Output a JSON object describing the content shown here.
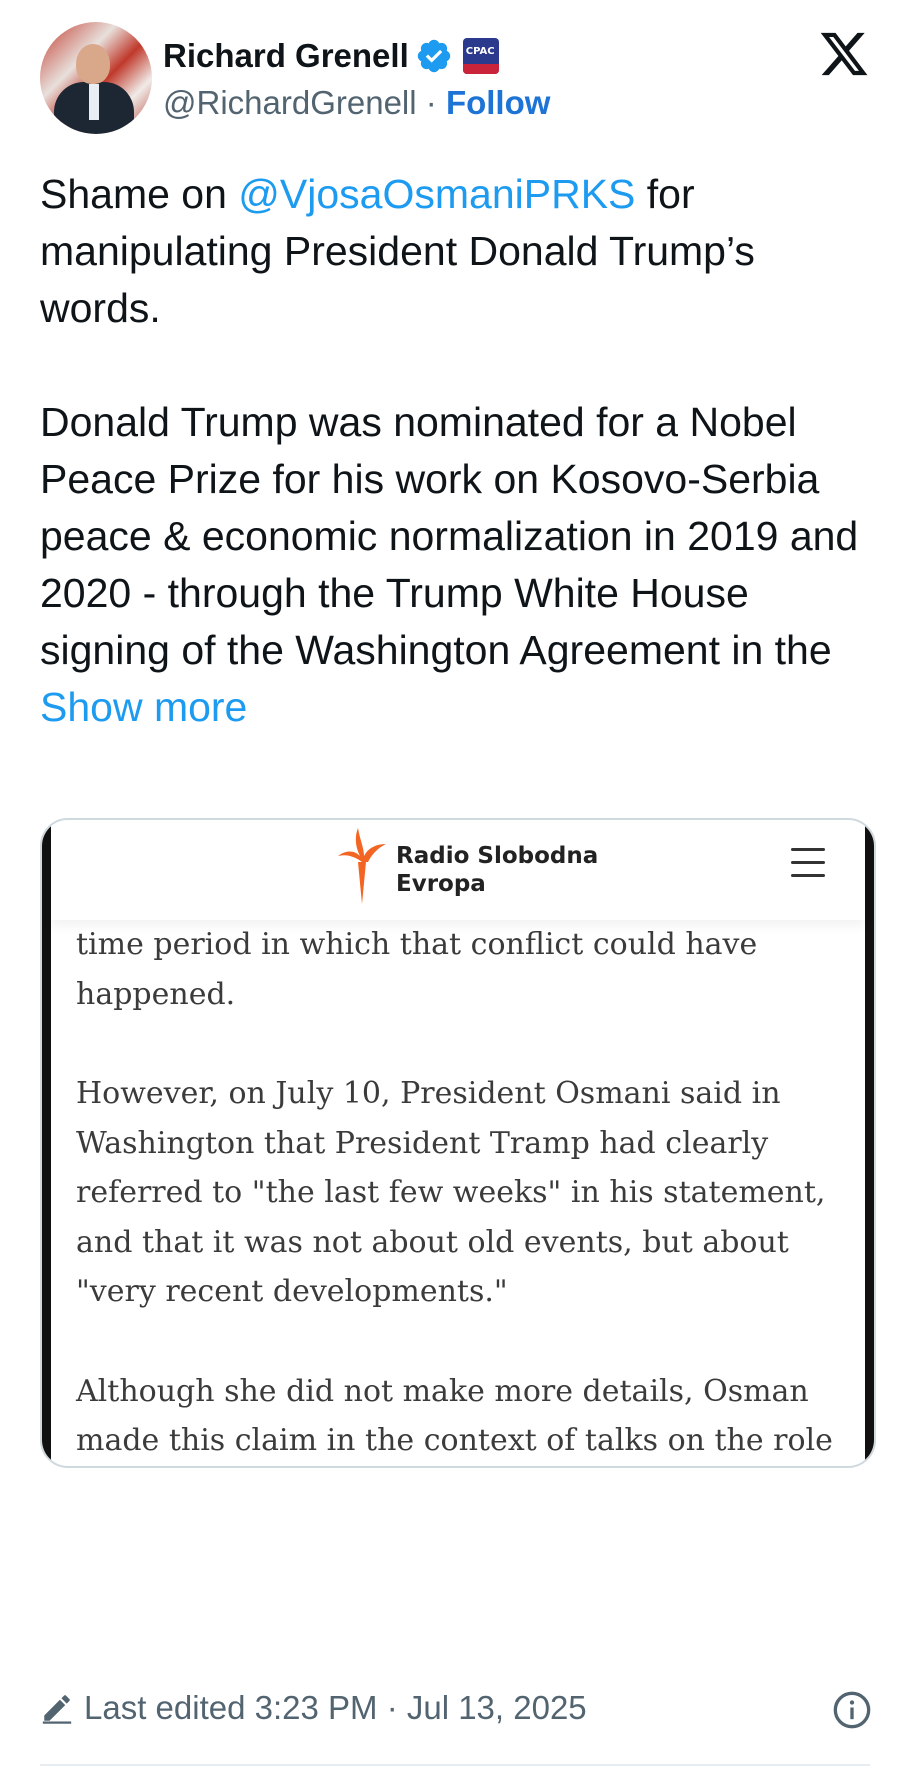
{
  "author": {
    "name": "Richard Grenell",
    "handle": "@RichardGrenell",
    "separator": "·",
    "follow_label": "Follow",
    "affiliation_badge": "CPAC"
  },
  "tweet": {
    "line1_prefix": "Shame on ",
    "mention": "@VjosaOsmaniPRKS",
    "line1_suffix": " for manipulating President Donald Trump’s words.",
    "paragraph2": "Donald Trump was nominated for a Nobel Peace Prize for his work on Kosovo-Serbia peace & economic normalization in 2019 and 2020 - through the Trump White House signing of the Washington Agreement in the ",
    "show_more_label": "Show more"
  },
  "media": {
    "site_name_line1": "Radio Slobodna",
    "site_name_line2": "Evropa",
    "paragraphs": [
      "time period in which that conflict could have happened.",
      "However, on July 10, President Osmani said in Washington that President Tramp had clearly referred to \"the last few weeks\" in his statement, and that it was not about old events, but about \"very recent developments.\"",
      "Although she did not make more details, Osman made this claim in the context of talks on the role of the United States in the stability of the Western Balkans, and added that Tramp has so far done everything in his power to provide peace in the region."
    ]
  },
  "footer": {
    "edited_label": "Last edited 3:23 PM · Jul 13, 2025"
  },
  "colors": {
    "link": "#1d9bf0",
    "follow": "#1d73d6",
    "verified": "#1d9bf0",
    "secondary_text": "#536471",
    "rse_orange": "#f26522"
  },
  "icons": {
    "verified": "verified-badge-icon",
    "x_logo": "x-logo-icon",
    "edit": "pencil-icon",
    "info": "info-icon",
    "menu": "hamburger-menu-icon",
    "rse_logo": "torch-logo-icon"
  }
}
